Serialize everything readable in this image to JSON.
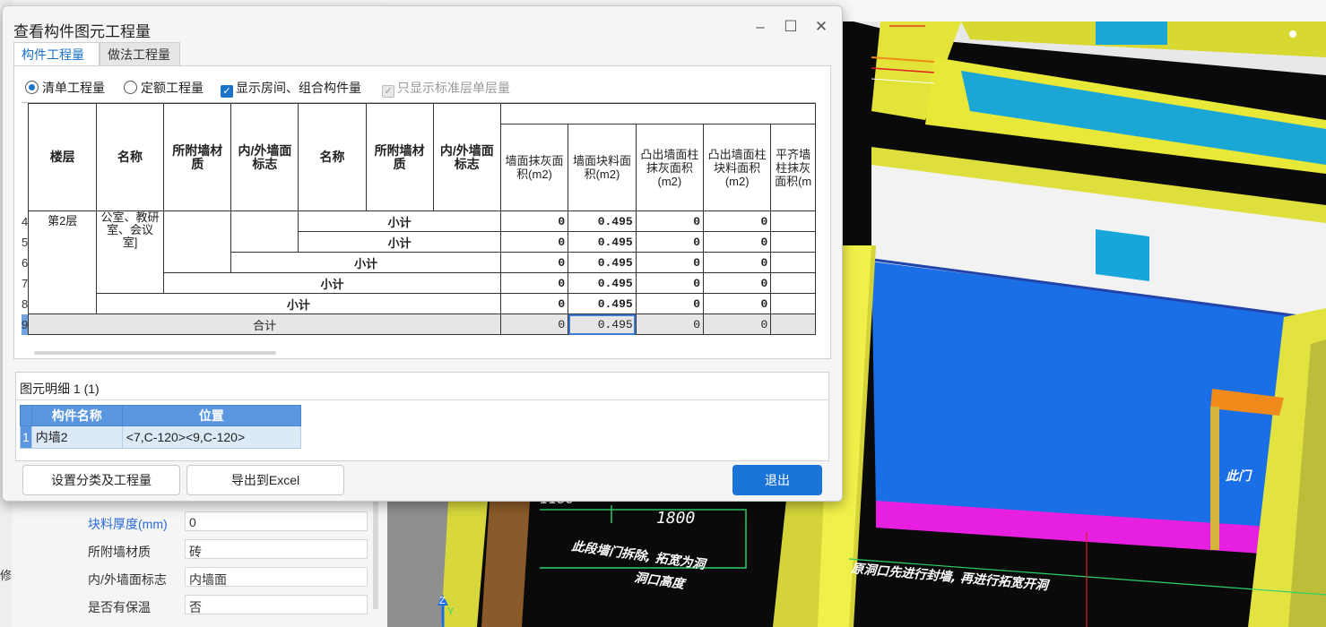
{
  "background_props": [
    {
      "label": "块料厚度(mm)",
      "value": "0",
      "highlight": true
    },
    {
      "label": "所附墙材质",
      "value": "砖"
    },
    {
      "label": "内/外墙面标志",
      "value": "内墙面"
    },
    {
      "label": "是否有保温",
      "value": "否"
    }
  ],
  "side_text": "修",
  "viewport": {
    "dimension": "1800",
    "dim_partial": "1180",
    "annotation_1": "此段墙门拆除, 拓宽为洞",
    "annotation_2": "洞口高度",
    "annotation_3": "原洞口先进行封墙, 再进行拓宽开洞",
    "annotation_4": "此门",
    "axis_z": "Z",
    "axis_y": "Y"
  },
  "dialog": {
    "title": "查看构件图元工程量",
    "tabs": [
      "构件工程量",
      "做法工程量"
    ],
    "options": {
      "radio_qingdan": "清单工程量",
      "radio_dinge": "定额工程量",
      "check_show_rooms": "显示房间、组合构件量",
      "check_standard_floor": "只显示标准层单层量"
    },
    "table": {
      "headers": [
        "楼层",
        "名称",
        "所附墙材质",
        "内/外墙面标志",
        "名称",
        "所附墙材质",
        "内/外墙面标志",
        "墙面抹灰面积(m2)",
        "墙面块料面积(m2)",
        "凸出墙面柱抹灰面积(m2)",
        "凸出墙面柱块料面积(m2)",
        "平齐墙柱抹灰面积(m"
      ],
      "floor": "第2层",
      "name_cell": "公室、教研室、会议室]",
      "row_numbers": [
        "4",
        "5",
        "6",
        "7",
        "8",
        "9"
      ],
      "subtotal_label": "小计",
      "total_label": "合计",
      "rows": [
        {
          "v1": "0",
          "v2": "0.495",
          "v3": "0",
          "v4": "0"
        },
        {
          "v1": "0",
          "v2": "0.495",
          "v3": "0",
          "v4": "0"
        },
        {
          "v1": "0",
          "v2": "0.495",
          "v3": "0",
          "v4": "0"
        },
        {
          "v1": "0",
          "v2": "0.495",
          "v3": "0",
          "v4": "0"
        },
        {
          "v1": "0",
          "v2": "0.495",
          "v3": "0",
          "v4": "0"
        },
        {
          "v1": "0",
          "v2": "0.495",
          "v3": "0",
          "v4": "0"
        }
      ]
    },
    "detail": {
      "title": "图元明细  1 (1)",
      "col_name": "构件名称",
      "col_position": "位置",
      "row_index": "1",
      "row_name": "内墙2",
      "row_position": "<7,C-120><9,C-120>"
    },
    "buttons": {
      "set_category": "设置分类及工程量",
      "export_excel": "导出到Excel",
      "exit": "退出"
    }
  }
}
